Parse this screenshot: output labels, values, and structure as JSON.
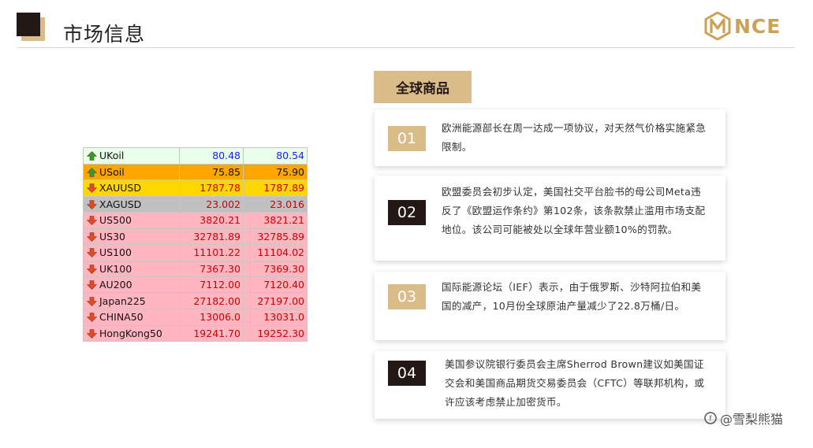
{
  "header": {
    "title": "市场信息",
    "logo_text": "NCE"
  },
  "quotes": [
    {
      "symbol": "UKoil",
      "bid": "80.48",
      "ask": "80.54",
      "dir": "up",
      "bg": "#eaffea",
      "color": "#1a1aff"
    },
    {
      "symbol": "USoil",
      "bid": "75.85",
      "ask": "75.90",
      "dir": "up",
      "bg": "#ffa500",
      "color": "#111111"
    },
    {
      "symbol": "XAUUSD",
      "bid": "1787.78",
      "ask": "1787.89",
      "dir": "down",
      "bg": "#ffd700",
      "color": "#cc0000"
    },
    {
      "symbol": "XAGUSD",
      "bid": "23.002",
      "ask": "23.016",
      "dir": "down",
      "bg": "#c0c0c0",
      "color": "#cc0000"
    },
    {
      "symbol": "US500",
      "bid": "3820.21",
      "ask": "3821.21",
      "dir": "down",
      "bg": "#ffb6c1",
      "color": "#cc0000"
    },
    {
      "symbol": "US30",
      "bid": "32781.89",
      "ask": "32785.89",
      "dir": "down",
      "bg": "#ffb6c1",
      "color": "#cc0000"
    },
    {
      "symbol": "US100",
      "bid": "11101.22",
      "ask": "11104.02",
      "dir": "down",
      "bg": "#ffb6c1",
      "color": "#cc0000"
    },
    {
      "symbol": "UK100",
      "bid": "7367.30",
      "ask": "7369.30",
      "dir": "down",
      "bg": "#ffb6c1",
      "color": "#cc0000"
    },
    {
      "symbol": "AU200",
      "bid": "7112.00",
      "ask": "7120.40",
      "dir": "down",
      "bg": "#ffb6c1",
      "color": "#cc0000"
    },
    {
      "symbol": "Japan225",
      "bid": "27182.00",
      "ask": "27197.00",
      "dir": "down",
      "bg": "#ffb6c1",
      "color": "#cc0000"
    },
    {
      "symbol": "CHINA50",
      "bid": "13006.0",
      "ask": "13031.0",
      "dir": "down",
      "bg": "#ffb6c1",
      "color": "#cc0000"
    },
    {
      "symbol": "HongKong50",
      "bid": "19241.70",
      "ask": "19252.30",
      "dir": "down",
      "bg": "#ffb6c1",
      "color": "#cc0000"
    }
  ],
  "section_tag": "全球商品",
  "news": [
    {
      "num": "01",
      "text": "欧洲能源部长在周一达成一项协议，对天然气价格实施紧急限制。"
    },
    {
      "num": "02",
      "text": "欧盟委员会初步认定，美国社交平台脸书的母公司Meta违反了《欧盟运作条约》第102条，该条款禁止滥用市场支配地位。该公司可能被处以全球年营业额10%的罚款。"
    },
    {
      "num": "03",
      "text": "国际能源论坛（IEF）表示，由于俄罗斯、沙特阿拉伯和美国的减产，10月份全球原油产量减少了22.8万桶/日。"
    },
    {
      "num": "04",
      "text": "美国参议院银行委员会主席Sherrod Brown建议如美国证交会和美国商品期货交易委员会（CFTC）等联邦机构，或许应该考虑禁止加密货币。"
    }
  ],
  "watermark": "@雪梨熊猫",
  "colors": {
    "gold": "#d9bc88",
    "dark": "#231815",
    "up_arrow": "#2e9e2e",
    "down_arrow": "#e24a2a"
  }
}
